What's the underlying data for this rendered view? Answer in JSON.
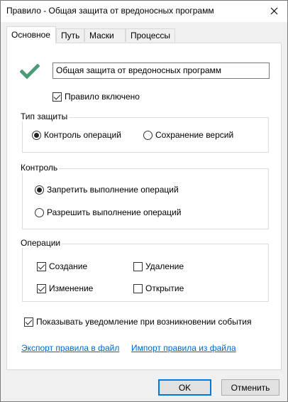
{
  "window": {
    "title": "Правило - Общая защита от вредоносных программ"
  },
  "tabs": [
    {
      "label": "Основное",
      "active": true
    },
    {
      "label": "Путь",
      "active": false
    },
    {
      "label": "Маски",
      "active": false
    },
    {
      "label": "Процессы",
      "active": false
    }
  ],
  "rule": {
    "icon": "checkmark-icon",
    "name_value": "Общая защита от вредоносных программ",
    "enabled_label": "Правило включено",
    "enabled": true
  },
  "protection_type": {
    "label": "Тип защиты",
    "options": [
      {
        "label": "Контроль операций",
        "selected": true
      },
      {
        "label": "Сохранение версий",
        "selected": false
      }
    ]
  },
  "control": {
    "label": "Контроль",
    "options": [
      {
        "label": "Запретить выполнение операций",
        "selected": true
      },
      {
        "label": "Разрешить выполнение операций",
        "selected": false
      }
    ]
  },
  "operations": {
    "label": "Операции",
    "items": [
      {
        "label": "Создание",
        "checked": true
      },
      {
        "label": "Удаление",
        "checked": false
      },
      {
        "label": "Изменение",
        "checked": true
      },
      {
        "label": "Открытие",
        "checked": false
      }
    ]
  },
  "notify": {
    "label": "Показывать уведомление при возникновении события",
    "checked": true
  },
  "links": {
    "export": "Экспорт правила в файл",
    "import": "Импорт правила из файла"
  },
  "buttons": {
    "ok": "OK",
    "cancel": "Отменить"
  },
  "colors": {
    "accent": "#0078d7",
    "link": "#0066cc",
    "check_icon": "#4e9a78"
  }
}
